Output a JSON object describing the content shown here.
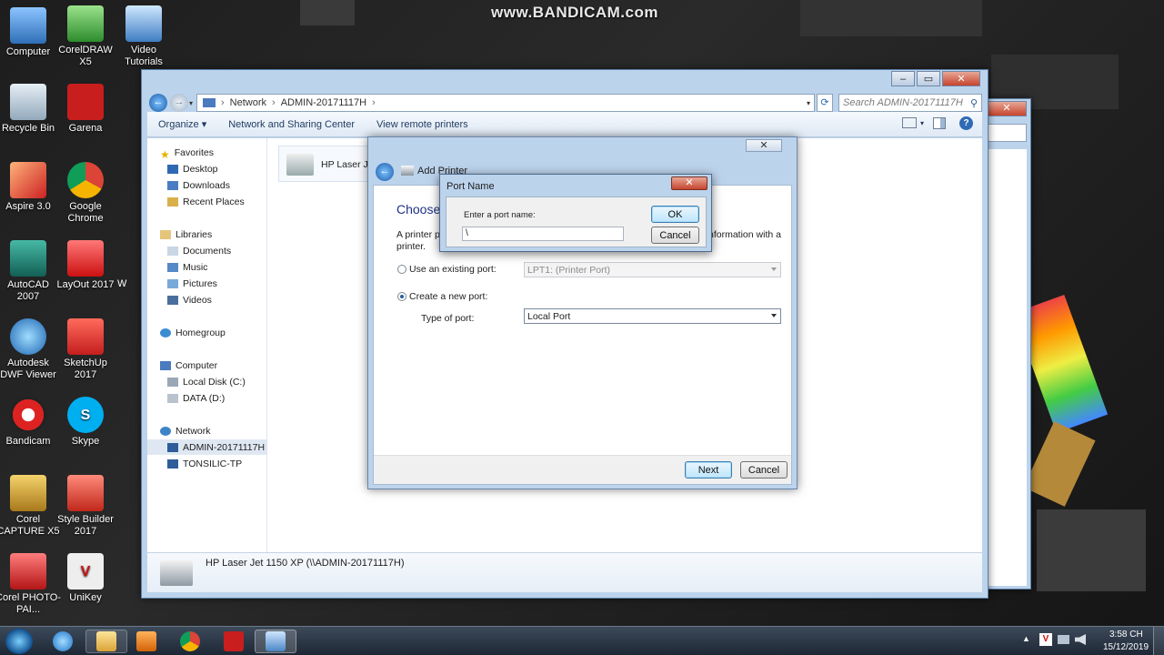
{
  "watermark": "www.BANDICAM.com",
  "desktop_icons": [
    {
      "label": "Computer"
    },
    {
      "label": "CorelDRAW X5"
    },
    {
      "label": "Video Tutorials"
    },
    {
      "label": "Recycle Bin"
    },
    {
      "label": "Garena"
    },
    {
      "label": "Aspire 3.0"
    },
    {
      "label": "Google Chrome"
    },
    {
      "label": "AutoCAD 2007"
    },
    {
      "label": "LayOut 2017"
    },
    {
      "label": "Autodesk DWF Viewer"
    },
    {
      "label": "SketchUp 2017"
    },
    {
      "label": "Bandicam"
    },
    {
      "label": "Skype"
    },
    {
      "label": "Corel CAPTURE X5"
    },
    {
      "label": "Style Builder 2017"
    },
    {
      "label": "Corel PHOTO-PAI..."
    },
    {
      "label": "UniKey"
    }
  ],
  "desktop_partial_label": "W",
  "explorer": {
    "breadcrumb": [
      "Network",
      "ADMIN-20171117H"
    ],
    "search_placeholder": "Search ADMIN-20171117H",
    "toolbar": {
      "organize": "Organize",
      "network_sharing": "Network and Sharing Center",
      "view_remote": "View remote printers"
    },
    "nav": {
      "favorites": "Favorites",
      "desktop": "Desktop",
      "downloads": "Downloads",
      "recent": "Recent Places",
      "libraries": "Libraries",
      "documents": "Documents",
      "music": "Music",
      "pictures": "Pictures",
      "videos": "Videos",
      "homegroup": "Homegroup",
      "computer": "Computer",
      "local_disk": "Local Disk (C:)",
      "data": "DATA (D:)",
      "network": "Network",
      "admin": "ADMIN-20171117H",
      "tonsilic": "TONSILIC-TP"
    },
    "item_partial": "HP Laser Jet",
    "details_title": "HP Laser Jet 1150 XP (\\\\ADMIN-20171117H)"
  },
  "wizard": {
    "title": "Add Printer",
    "heading_partial": "Choose a",
    "desc_left": "A printer po",
    "desc_left2": "printer.",
    "desc_right": "nformation with a",
    "use_existing_label": "Use an existing port:",
    "use_existing_value": "LPT1: (Printer Port)",
    "create_new_label": "Create a new port:",
    "type_of_port_label": "Type of port:",
    "type_of_port_value": "Local Port",
    "next": "Next",
    "cancel": "Cancel"
  },
  "port_dialog": {
    "title": "Port Name",
    "prompt": "Enter a port name:",
    "input_value": "\\",
    "ok": "OK",
    "cancel": "Cancel"
  },
  "taskbar": {
    "time": "3:58 CH",
    "date": "15/12/2019"
  }
}
